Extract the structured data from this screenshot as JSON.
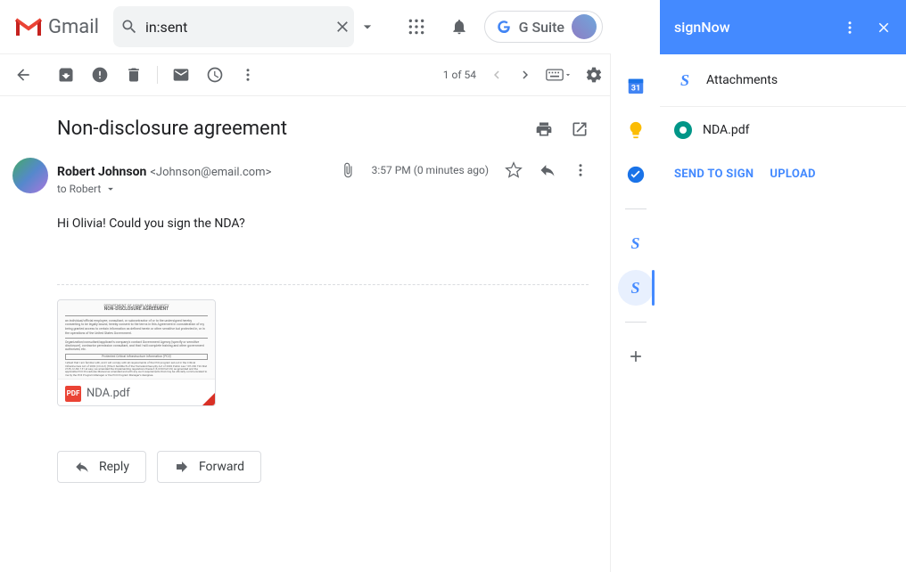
{
  "app": {
    "name": "Gmail"
  },
  "search": {
    "value": "in:sent"
  },
  "gsuite": {
    "label": "G Suite"
  },
  "toolbar": {
    "page_count": "1 of 54"
  },
  "message": {
    "subject": "Non-disclosure agreement",
    "sender_name": "Robert Johnson",
    "sender_email": "<Johnson@email.com>",
    "to_line": "to Robert",
    "timestamp": "3:57 PM (0 minutes ago)",
    "body": "Hi Olivia! Could you sign the NDA?",
    "attachment_name": "NDA.pdf",
    "att_preview_title": "NON-DISCLOSURE AGREEMENT",
    "pdf_badge": "PDF"
  },
  "actions": {
    "reply": "Reply",
    "forward": "Forward"
  },
  "signnow": {
    "title": "signNow",
    "section": "Attachments",
    "items": [
      "NDA.pdf"
    ],
    "send_to_sign": "SEND TO SIGN",
    "upload": "UPLOAD"
  }
}
